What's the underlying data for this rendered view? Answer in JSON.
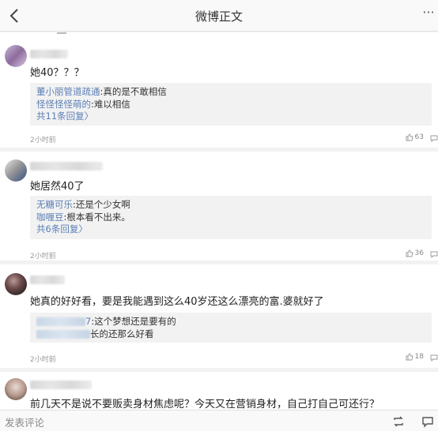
{
  "header": {
    "title": "微博正文",
    "more": "···"
  },
  "comments": [
    {
      "text": "她40？？？",
      "replies": [
        {
          "name": "董小丽管道疏通",
          "text": ":真的是不敢相信"
        },
        {
          "name": "怪怪怪怪萌的",
          "text": ":难以相信"
        }
      ],
      "more_replies": "共11条回复〉",
      "time": "2小时前",
      "likes": "63"
    },
    {
      "text": "她居然40了",
      "replies": [
        {
          "name": "无糖可乐",
          "text": ":还是个少女啊"
        },
        {
          "name": "咖喱豆",
          "text": ":根本看不出来。"
        }
      ],
      "more_replies": "共6条回复〉",
      "time": "2小时前",
      "likes": "36"
    },
    {
      "text": "她真的好好看，要是我能遇到这么40岁还这么漂亮的富.婆就好了",
      "replies": [
        {
          "name_suffix": "7",
          "text": ":这个梦想还是要有的"
        },
        {
          "name_suffix": "",
          "text": "长的还那么好看"
        }
      ],
      "time": "2小时前",
      "likes": "18"
    },
    {
      "text": "前几天不是说不要贩卖身材焦虑呢？今天又在营销身材，自己打自己可还行？"
    }
  ],
  "footer": {
    "placeholder": "发表评论"
  }
}
